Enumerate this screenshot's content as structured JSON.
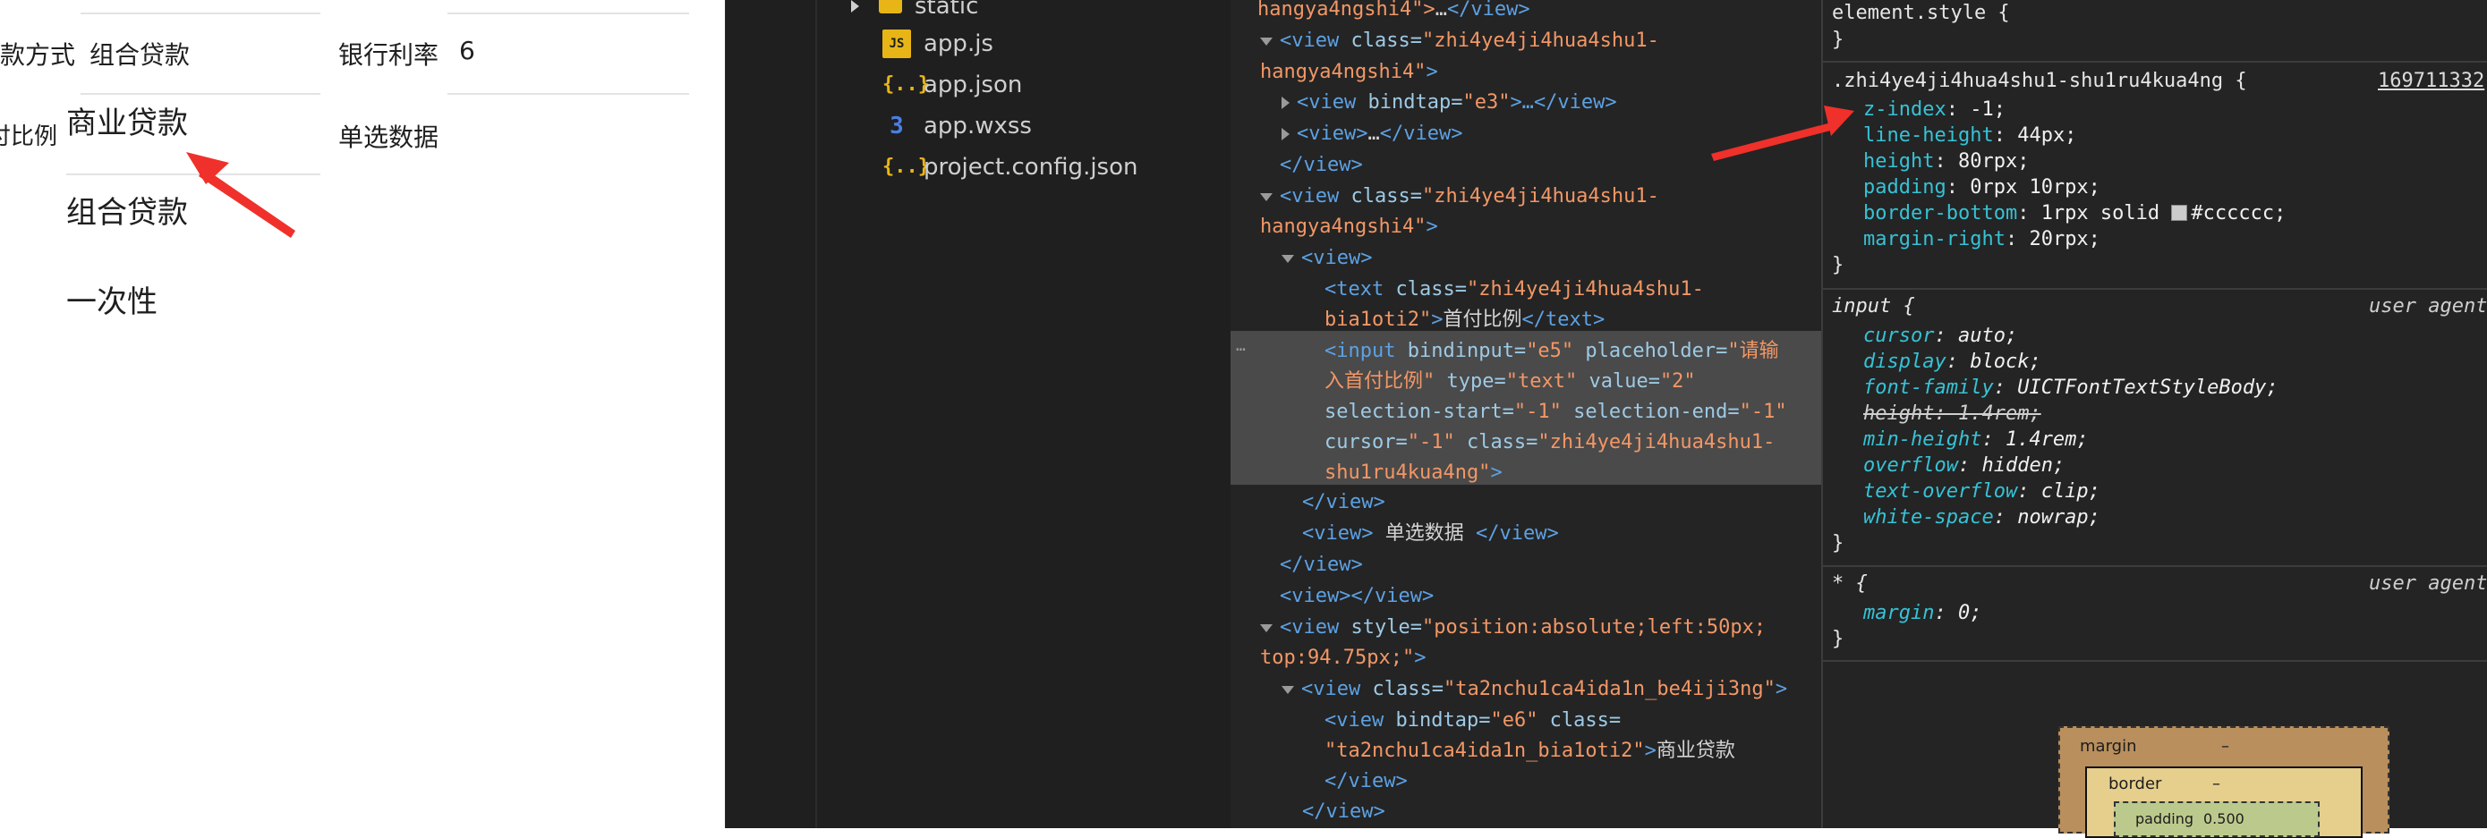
{
  "preview": {
    "row1_label_partial": "款方式",
    "row1_value": "组合贷款",
    "row1_right_label": "银行利率",
    "row1_right_value": "6",
    "row2_label_partial": "付比例",
    "row2_right_label": "单选数据",
    "options": [
      "商业贷款",
      "组合贷款",
      "一次性"
    ]
  },
  "filetree": {
    "items": [
      {
        "name": "static",
        "icon": "folder-icon"
      },
      {
        "name": "app.js",
        "icon": "js-file-icon"
      },
      {
        "name": "app.json",
        "icon": "json-file-icon"
      },
      {
        "name": "app.wxss",
        "icon": "css-file-icon"
      },
      {
        "name": "project.config.json",
        "icon": "json-file-icon"
      }
    ],
    "json_glyph": "{..}",
    "js_glyph": "JS",
    "css_glyph": "3"
  },
  "elements": {
    "l0": {
      "a": "hangya4ngshi4\">",
      "b": "…",
      "c": "</view>"
    },
    "l1": {
      "tag": "<view",
      "attr": " class=",
      "val": "\"zhi4ye4ji4hua4shu1-"
    },
    "l2": {
      "val": "hangya4ngshi4\"",
      "close": ">"
    },
    "l3": {
      "tag": "<view",
      "attr": " bindtap=",
      "val": "\"e3\"",
      "mid": ">…",
      "end": "</view>"
    },
    "l4": {
      "tag": "<view>",
      "mid": "…",
      "end": "</view>"
    },
    "l5": {
      "end": "</view>"
    },
    "l6": {
      "tag": "<view",
      "attr": " class=",
      "val": "\"zhi4ye4ji4hua4shu1-"
    },
    "l7": {
      "val": "hangya4ngshi4\"",
      "close": ">"
    },
    "l8": {
      "tag": "<view>"
    },
    "l9": {
      "tag": "<text",
      "attr": " class=",
      "val": "\"zhi4ye4ji4hua4shu1-"
    },
    "l10": {
      "val": "bia1oti2\"",
      "close": ">",
      "text": "首付比例",
      "end": "</text>"
    },
    "l11": {
      "tag": "<input",
      "attr1": " bindinput=",
      "val1": "\"e5\"",
      "attr2": " placeholder=",
      "val2": "\"请输"
    },
    "l12": {
      "val2": "入首付比例\"",
      "attr3": " type=",
      "val3": "\"text\"",
      "attr4": " value=",
      "val4": "\"2\""
    },
    "l13": {
      "attr5": "selection-start=",
      "val5": "\"-1\"",
      "attr6": " selection-end=",
      "val6": "\"-1\""
    },
    "l14": {
      "attr7": "cursor=",
      "val7": "\"-1\"",
      "attr8": " class=",
      "val8": "\"zhi4ye4ji4hua4shu1-"
    },
    "l15": {
      "val8": "shu1ru4kua4ng\"",
      "close": ">"
    },
    "l16": {
      "end": "</view>"
    },
    "l17": {
      "tag": "<view>",
      "text": " 单选数据 ",
      "end": "</view>"
    },
    "l18": {
      "end": "</view>"
    },
    "l19": {
      "tag": "<view>",
      "end": "</view>"
    },
    "l20": {
      "tag": "<view",
      "attr": " style=",
      "val": "\"position:absolute;left:50px;"
    },
    "l21": {
      "val": "top:94.75px;\"",
      "close": ">"
    },
    "l22": {
      "tag": "<view",
      "attr": " class=",
      "val": "\"ta2nchu1ca4ida1n_be4iji3ng\"",
      "close": ">"
    },
    "l23": {
      "tag": "<view",
      "attr": " bindtap=",
      "val": "\"e6\"",
      "attr2": " class="
    },
    "l24": {
      "val": "\"ta2nchu1ca4ida1n_bia1oti2\"",
      "close": ">",
      "text": "商业贷款"
    },
    "l25": {
      "end": "</view>"
    },
    "l26": {
      "end": "</view>"
    },
    "dots": "…"
  },
  "styles": {
    "element_style": "element.style {",
    "close": "}",
    "rule1_selector": ".zhi4ye4ji4hua4shu1-shu1ru4kua4ng {",
    "rule1_source": "169711332",
    "rule1_props": [
      {
        "name": "z-index",
        "value": "-1;"
      },
      {
        "name": "line-height",
        "value": "44px;"
      },
      {
        "name": "height",
        "value": "80rpx;"
      },
      {
        "name": "padding",
        "value": "0rpx 10rpx;"
      },
      {
        "name": "border-bottom",
        "value": "1rpx solid ",
        "swatch": "#cccccc",
        "tail": "#cccccc;"
      },
      {
        "name": "margin-right",
        "value": "20rpx;"
      }
    ],
    "rule2_selector": "input {",
    "user_agent": "user agent",
    "rule2_props": [
      {
        "name": "cursor",
        "value": "auto;"
      },
      {
        "name": "display",
        "value": "block;"
      },
      {
        "name": "font-family",
        "value": "UICTFontTextStyleBody;"
      },
      {
        "name": "height",
        "value": "1.4rem;",
        "struck": true
      },
      {
        "name": "min-height",
        "value": "1.4rem;"
      },
      {
        "name": "overflow",
        "value": "hidden;"
      },
      {
        "name": "text-overflow",
        "value": "clip;"
      },
      {
        "name": "white-space",
        "value": "nowrap;"
      }
    ],
    "rule3_selector": "* {",
    "rule3_props": [
      {
        "name": "margin",
        "value": "0;"
      }
    ],
    "box_model": {
      "margin_label": "margin",
      "margin_value": "–",
      "border_label": "border",
      "border_value": "–",
      "padding_label": "padding",
      "padding_value": "0.500"
    }
  },
  "colors": {
    "annotation_arrow": "#f0302a",
    "code_tag": "#5da1e3",
    "code_attr": "#9ecae5",
    "code_value": "#f29766",
    "css_property": "#36c2d6"
  }
}
